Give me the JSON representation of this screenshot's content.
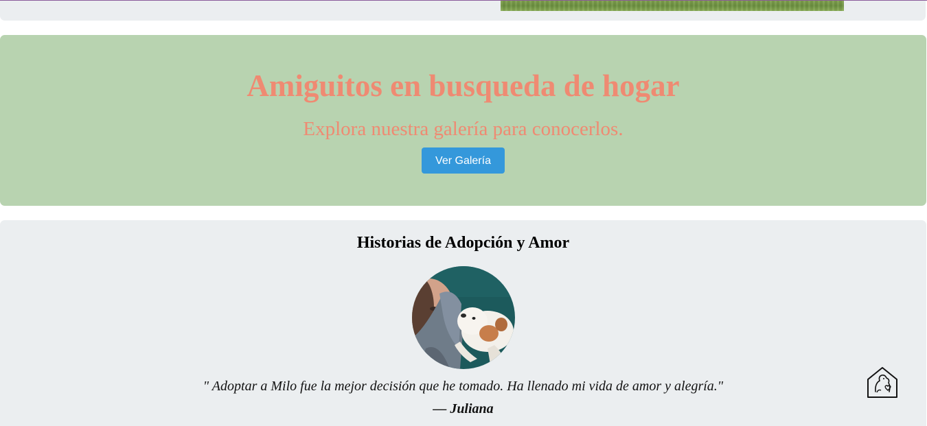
{
  "hero": {
    "title": "Amiguitos en busqueda de hogar",
    "subtitle": "Explora nuestra galería para conocerlos.",
    "button_label": "Ver Galería"
  },
  "stories": {
    "title": "Historias de Adopción y Amor",
    "quote": "\" Adoptar a Milo fue la mejor decisión que he tomado. Ha llenado mi vida de amor y alegría.\"",
    "author": "— Juliana"
  },
  "floating": {
    "icon": "home-pet-icon"
  },
  "colors": {
    "hero_bg": "#b8d3b0",
    "hero_text": "#ef8a72",
    "button_bg": "#3498db",
    "section_bg": "#ebeef0"
  }
}
